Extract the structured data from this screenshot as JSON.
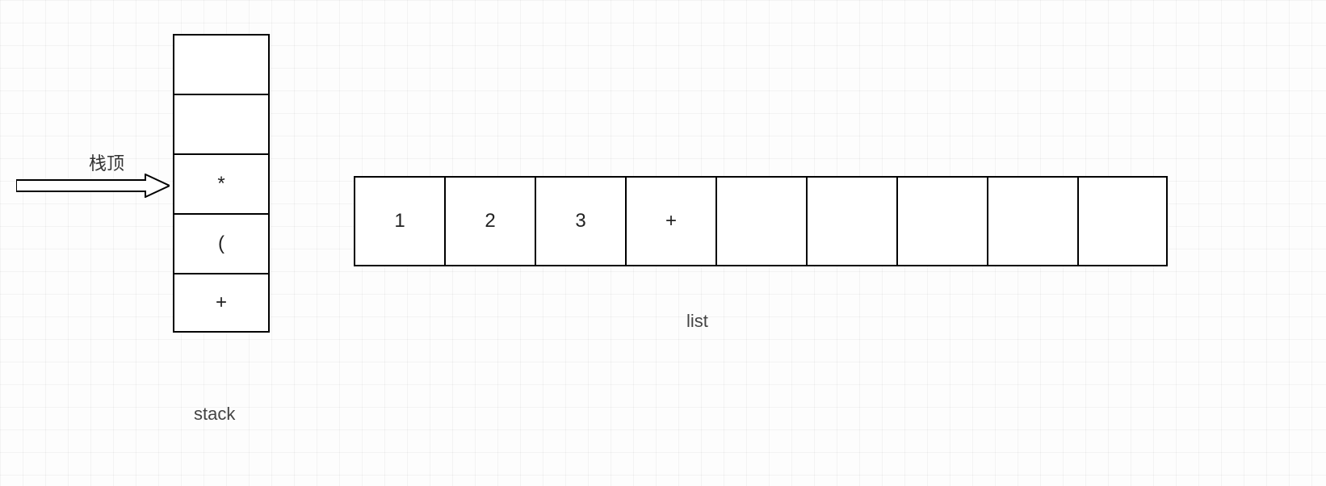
{
  "labels": {
    "top": "栈顶",
    "stack": "stack",
    "list": "list"
  },
  "stack": {
    "cells": [
      "",
      "",
      "*",
      "(",
      "+"
    ]
  },
  "list": {
    "cells": [
      "1",
      "2",
      "3",
      "+",
      "",
      "",
      "",
      "",
      ""
    ]
  }
}
